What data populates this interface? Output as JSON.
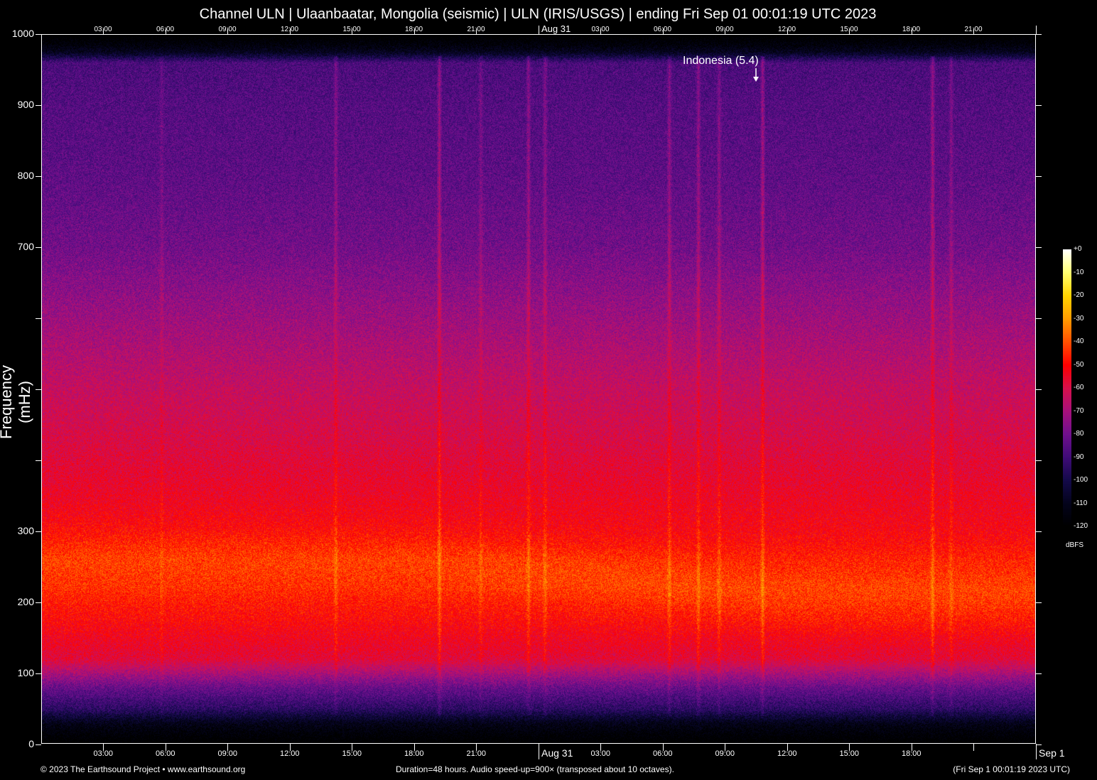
{
  "chart_data": {
    "type": "heatmap",
    "subtype": "spectrogram",
    "title": "Channel ULN | Ulaanbaatar, Mongolia (seismic) | ULN (IRIS/USGS) | ending Fri Sep 01 00:01:19 UTC 2023",
    "ylabel": "Frequency (mHz)",
    "ylim": [
      0,
      1000
    ],
    "y_ticks": [
      0,
      100,
      200,
      300,
      400,
      500,
      600,
      700,
      800,
      900,
      1000
    ],
    "y_tick_labels": [
      "0",
      "100",
      "200",
      "300",
      "",
      "",
      "",
      "700",
      "800",
      "900",
      "1000"
    ],
    "x_duration_hours": 48,
    "x_tick_hours": [
      3,
      6,
      9,
      12,
      15,
      18,
      21,
      24,
      27,
      30,
      33,
      36,
      39,
      42,
      45,
      48
    ],
    "x_tick_labels_bottom": [
      "03:00",
      "06:00",
      "09:00",
      "12:00",
      "15:00",
      "18:00",
      "21:00",
      "Aug 31",
      "03:00",
      "06:00",
      "09:00",
      "12:00",
      "15:00",
      "18:00",
      "",
      "Sep  1"
    ],
    "x_tick_labels_top": [
      "03:00",
      "06:00",
      "09:00",
      "12:00",
      "15:00",
      "18:00",
      "21:00",
      "Aug 31",
      "03:00",
      "06:00",
      "09:00",
      "12:00",
      "15:00",
      "18:00",
      "21:00",
      ""
    ],
    "colorbar": {
      "label": "dBFS",
      "range": [
        -120,
        0
      ],
      "tick_labels": [
        "+0",
        "-10",
        "-20",
        "-30",
        "-40",
        "-50",
        "-60",
        "-70",
        "-80",
        "-90",
        "-100",
        "-110",
        "-120"
      ],
      "colors": [
        "#ffffff",
        "#ffff70",
        "#ffd400",
        "#ff9c00",
        "#ff5000",
        "#ff0000",
        "#d8104c",
        "#a8107c",
        "#70108e",
        "#400c78",
        "#140a4a",
        "#04041c",
        "#000000"
      ]
    },
    "spectrum_profile_dbfs": {
      "freq_mHz": [
        0,
        30,
        50,
        80,
        120,
        180,
        220,
        260,
        300,
        400,
        500,
        600,
        700,
        800,
        900,
        960,
        975,
        1000
      ],
      "level": [
        -125,
        -112,
        -95,
        -82,
        -58,
        -50,
        -46,
        -47,
        -52,
        -58,
        -64,
        -72,
        -80,
        -84,
        -86,
        -88,
        -110,
        -125
      ]
    },
    "events_hours": [
      5.8,
      14.2,
      19.2,
      21.2,
      23.5,
      24.3,
      30.3,
      31.7,
      32.7,
      34.8,
      43.0,
      43.9
    ],
    "event_strength": [
      0.4,
      0.7,
      1.0,
      0.5,
      0.8,
      0.7,
      0.8,
      0.8,
      0.7,
      1.0,
      1.0,
      0.6
    ],
    "annotation": {
      "text": "Indonesia (5.4)",
      "hour": 34.8
    }
  },
  "footer": {
    "left": "© 2023 The Earthsound Project • www.earthsound.org",
    "center": "Duration=48 hours. Audio speed-up=900× (transposed about 10 octaves).",
    "right": "(Fri Sep  1 00:01:19 2023 UTC)"
  }
}
